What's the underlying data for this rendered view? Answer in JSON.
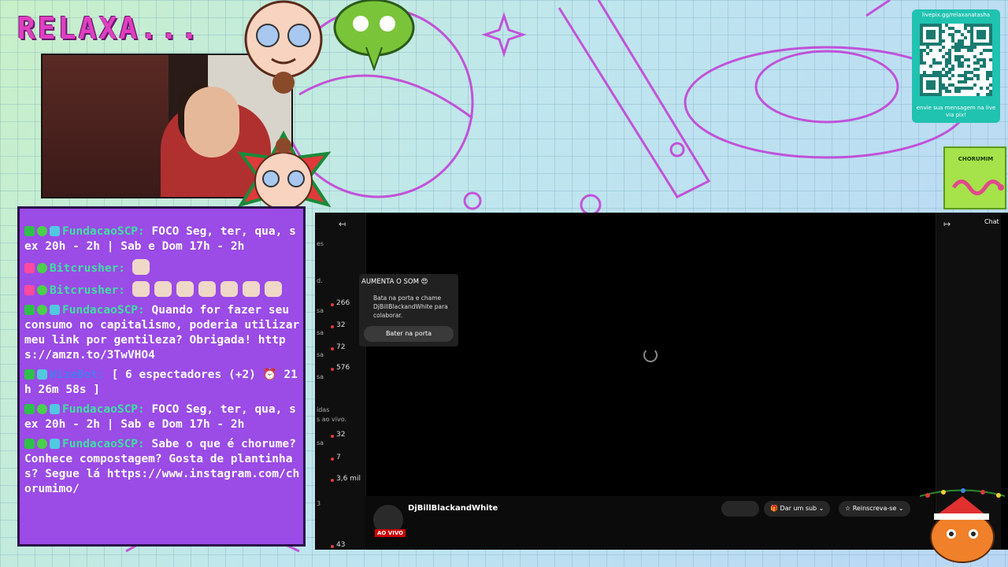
{
  "overlay": {
    "title": "RELAXA...",
    "qr_label": "livepix.gg/relaxanatasha",
    "qr_caption": "envie sua mensagem na live via pix!",
    "chorumim_label": "CHORUMIM"
  },
  "chat": {
    "messages": [
      {
        "user": "FundacaoSCP:",
        "text": " FOCO Seg, ter, qua, sex 20h - 2h | Sab e Dom 17h - 2h",
        "badges": [
          "green",
          "alien",
          "bot"
        ]
      },
      {
        "user": "Bitcrusher:",
        "text": "",
        "badges": [
          "heart",
          "alien"
        ],
        "emotes": 1
      },
      {
        "user": "Bitcrusher:",
        "text": "",
        "badges": [
          "heart",
          "alien"
        ],
        "emotes": 7
      },
      {
        "user": "FundacaoSCP:",
        "text": " Quando for fazer seu consumo no capitalismo, poderia utilizar meu link por gentileza? Obrigada! https://amzn.to/3TwVHO4",
        "badges": [
          "green",
          "alien",
          "bot"
        ]
      },
      {
        "user": "WizeBot:",
        "text": " [ 6 espectadores (+2) ⏰ 21h 26m 58s ]",
        "badges": [
          "green",
          "bot"
        ]
      },
      {
        "user": "FundacaoSCP:",
        "text": " FOCO Seg, ter, qua, sex 20h - 2h | Sab e Dom 17h - 2h",
        "badges": [
          "green",
          "alien",
          "bot"
        ]
      },
      {
        "user": "FundacaoSCP:",
        "text": " Sabe o que é chorume? Conhece compostagem? Gosta de plantinhas? Segue lá https://www.instagram.com/chorumimo/",
        "badges": [
          "green",
          "alien",
          "bot"
        ]
      }
    ]
  },
  "player": {
    "left_rail": {
      "counts": [
        "266",
        "32",
        "72",
        "576",
        "32",
        "7",
        "3,6 mil",
        "43"
      ],
      "snippets": [
        "es",
        "d.",
        "sa",
        "sa",
        "sa",
        "sa",
        "ídas",
        "s ao vivo.",
        "sa",
        "3"
      ]
    },
    "popup": {
      "title": "AUMENTA O SOM 😍",
      "body": "Bata na porta e chame DjBillBlackandWhite para colaborar.",
      "button": "Bater na porta"
    },
    "channel_name": "DjBillBlackandWhite",
    "live_badge": "AO VIVO",
    "gift_button": "Dar um sub",
    "subscribe_button": "Reinscreva-se",
    "chat_label": "Chat"
  },
  "colors": {
    "panel_purple": "#9b4be6",
    "username_green": "#3ee0a0",
    "title_pink": "#e040c0",
    "live_red": "#cc0000"
  }
}
